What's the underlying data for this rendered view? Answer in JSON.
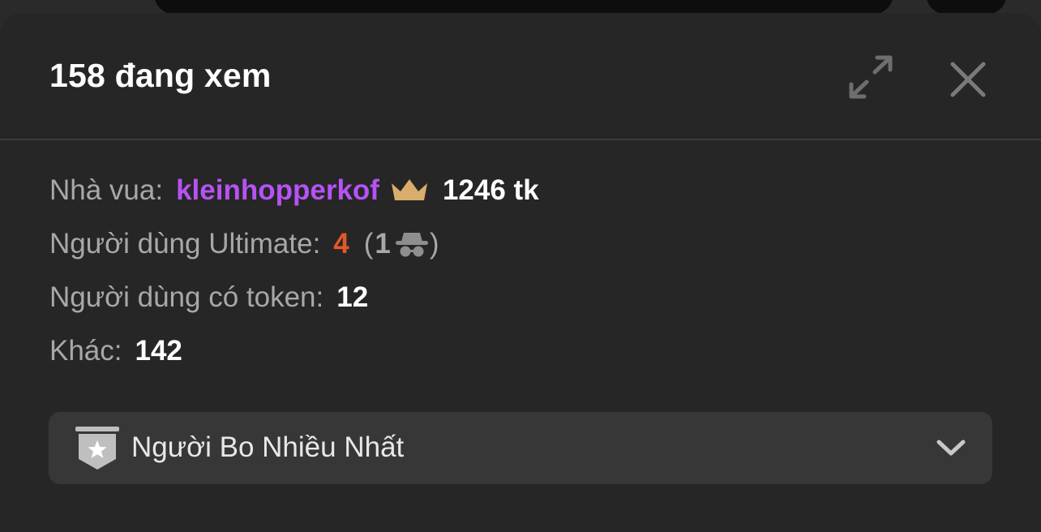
{
  "header": {
    "title": "158 đang xem",
    "expand_icon": "expand-icon",
    "close_icon": "close-icon"
  },
  "stats": {
    "king": {
      "label": "Nhà vua:",
      "username": "kleinhopperkof",
      "icon": "crown-icon",
      "tokens": "1246 tk"
    },
    "ultimate": {
      "label": "Người dùng Ultimate:",
      "count": "4",
      "paren_open": "(",
      "anonymous_count": "1",
      "anonymous_icon": "spy-icon",
      "paren_close": ")"
    },
    "token_users": {
      "label": "Người dùng có token:",
      "count": "12"
    },
    "other": {
      "label": "Khác:",
      "count": "142"
    }
  },
  "dropdown": {
    "icon": "star-badge-icon",
    "label": "Người Bo Nhiều Nhất",
    "chevron_icon": "chevron-down-icon"
  },
  "colors": {
    "panel_background": "#262626",
    "king_name": "#b553f5",
    "crown": "#d9ad6b",
    "ultimate_count": "#e2582b",
    "muted_text": "#a8a8a8",
    "dropdown_background": "#373737"
  }
}
